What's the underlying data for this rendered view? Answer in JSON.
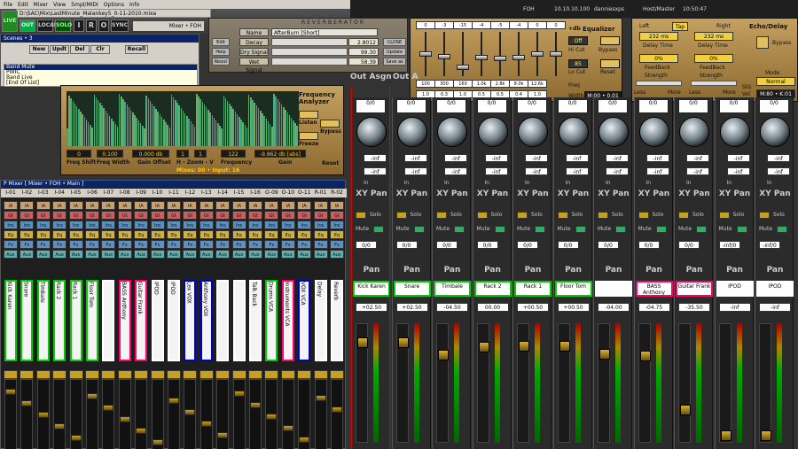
{
  "menubar": {
    "items": [
      "File",
      "Edit",
      "Mixer",
      "View",
      "Smpl/MIDI",
      "Options",
      "Info"
    ]
  },
  "path": "D:\\SAC\\Mix\\LastMinute_Malankey5_0-11-2010.mixa",
  "topbuttons": {
    "live": "LIVE",
    "out": "OUT",
    "solo": "SOLO",
    "i": "I",
    "r": "R",
    "o": "O",
    "sync": "SYNC"
  },
  "mixer_select": "Mixer • FOH",
  "header": {
    "foh": "FOH",
    "ip": "10.10.10.100",
    "user": "danniesxps",
    "host": "Host/Master",
    "time": "10:50:47"
  },
  "reverb": {
    "title": "REVERBERATOR",
    "buttons": [
      "Edit",
      "Help",
      "About"
    ],
    "name_label": "Name",
    "name_value": "AfterBurn [Short]",
    "rows": [
      {
        "label": "Decay",
        "value": "2.8012"
      },
      {
        "label": "Dry Signal",
        "value": "99.30"
      },
      {
        "label": "Wet Signal",
        "value": "58.39"
      }
    ],
    "right_buttons": [
      "CLOSE",
      "Update",
      "Save as"
    ]
  },
  "eq": {
    "gains": [
      "0",
      "-3",
      "-15",
      "-4",
      "-5",
      "-4",
      "0",
      "0"
    ],
    "freqs": [
      "100",
      "300",
      "160",
      "1.0k",
      "2.8k",
      "8.0k",
      "12.6k"
    ],
    "qs": [
      "1.0",
      "0.3",
      "1.0",
      "0.5",
      "0.5",
      "0.4",
      "1.0"
    ],
    "title": "Equalizer",
    "db": "+db",
    "off": "Off",
    "hicut": "Hi Cut",
    "hicut_val": "85",
    "locut": "Lo Cut",
    "freq": "Freq",
    "width": "Width",
    "bypass": "Bypass",
    "reset": "Reset",
    "mix": "M:00 • 0.01"
  },
  "echo": {
    "title": "Echo/Delay",
    "left": "Left",
    "tap": "Tap",
    "right": "Right",
    "left_ms": "232 ms",
    "right_ms": "232 ms",
    "delay_time": "Delay Time",
    "fb_left": "0%",
    "fb_right": "0%",
    "feedback": "FeedBack",
    "strength": "Strength",
    "less": "Less",
    "more": "More",
    "bypass": "Bypass",
    "mode": "Mode",
    "mode_val": "Normal",
    "mix": "M:80 • K:01",
    "sig": "SIG",
    "vol": "Vol"
  },
  "scenes": {
    "title": "Scenes • 3",
    "buttons": [
      "New",
      "Updt",
      "Del",
      "Clr",
      "Recall"
    ],
    "list": [
      "Band Mute",
      "PWIC",
      "Band Live",
      "[End Of List]"
    ]
  },
  "analyzer": {
    "title": "Frequency Analyzer",
    "buttons": [
      "Listen",
      "Bypass",
      "Freeze",
      "Reset"
    ],
    "values": [
      "0",
      "0.100",
      "0.000 db",
      "1",
      "1",
      "122",
      "-9.862 db [abs]"
    ],
    "labels": [
      "Freq Shift",
      "Freq Width",
      "Gain Offset",
      "H - Zoom - V",
      "Frequency",
      "Gain"
    ],
    "footer": "Mixes: 00 • Input: 16"
  },
  "pmixer": {
    "title": "P Mixer [ Mixer • FOH • Main ]",
    "cols": [
      "I-01",
      "I-02",
      "I-03",
      "I-04",
      "I-05",
      "I-06",
      "I-07",
      "I-08",
      "I-09",
      "I-10",
      "I-11",
      "I-12",
      "I-13",
      "I-14",
      "I-15",
      "I-16",
      "O-09",
      "O-10",
      "O-11",
      "R-01",
      "R-02"
    ],
    "rows": [
      "IA",
      "Gt",
      "Ins",
      "Eq",
      "Fx",
      "Aux"
    ],
    "names": [
      "Kick Karen",
      "Snare",
      "Timbale",
      "Rack 2",
      "Rack 1",
      "Floor Tom",
      "",
      "BASS Anthony",
      "Guitar Frank",
      "IPOD",
      "IPOD",
      "Lex VOX",
      "Anthony VOX",
      "",
      "",
      "Talk Back",
      "Drums VCA",
      "Instruments VCA",
      "VOX VCA",
      "Delay",
      "Reverb"
    ],
    "name_colors": [
      "#0c0",
      "#0c0",
      "#0c0",
      "#0c0",
      "#0c0",
      "#0c0",
      "#fff",
      "#f06",
      "#f06",
      "#fff",
      "#fff",
      "#00c",
      "#00c",
      "#fff",
      "#fff",
      "#fff",
      "#0c0",
      "#f06",
      "#00c",
      "#fff",
      "#fff"
    ]
  },
  "strips": {
    "out_asgn": "Out Asgn",
    "out_asgn2": "Out A",
    "xypan": "XY Pan",
    "pan": "Pan",
    "solo": "Solo",
    "mute": "Mute",
    "inf": "-inf",
    "in": "In",
    "channels": [
      {
        "name": "Kick Karen",
        "top": "0/0",
        "vol": "+02.50",
        "pan": "0/0",
        "color": "#0c0"
      },
      {
        "name": "Snare",
        "top": "0/0",
        "vol": "+02.50",
        "pan": "0/0",
        "color": "#0c0"
      },
      {
        "name": "Timbale",
        "top": "0/0",
        "vol": "-04.50",
        "pan": "0/0",
        "color": "#0c0"
      },
      {
        "name": "Rack 2",
        "top": "0/0",
        "vol": "00.00",
        "pan": "0/0",
        "color": "#0c0"
      },
      {
        "name": "Rack 1",
        "top": "0/0",
        "vol": "+00.50",
        "pan": "0/0",
        "color": "#0c0"
      },
      {
        "name": "Floor Tom",
        "top": "0/0",
        "vol": "+00.50",
        "pan": "0/0",
        "color": "#0c0"
      },
      {
        "name": "",
        "top": "0/0",
        "vol": "-04.00",
        "pan": "0/0",
        "color": "#fff"
      },
      {
        "name": "BASS Anthony",
        "top": "0/0",
        "vol": "-04.75",
        "pan": "0/0",
        "color": "#f06"
      },
      {
        "name": "Guitar Frank",
        "top": "0/0",
        "vol": "-35.50",
        "pan": "0/0",
        "color": "#f06"
      },
      {
        "name": "IPOD",
        "top": "0/0",
        "vol": "-inf",
        "pan": "-inf/0",
        "color": "#fff"
      },
      {
        "name": "IPOD",
        "top": "0/0",
        "vol": "-inf",
        "pan": "-inf/0",
        "color": "#fff"
      }
    ]
  }
}
